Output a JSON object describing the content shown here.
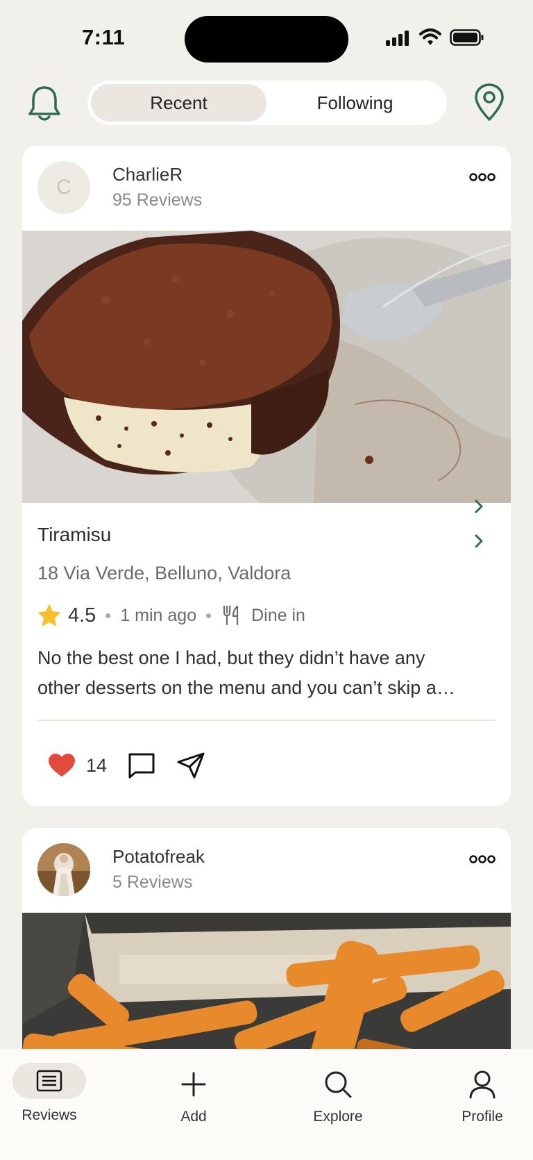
{
  "status_bar": {
    "time": "7:11"
  },
  "header": {
    "tabs": [
      {
        "label": "Recent",
        "active": true
      },
      {
        "label": "Following",
        "active": false
      }
    ]
  },
  "posts": [
    {
      "user": {
        "name": "CharlieR",
        "initial": "C",
        "reviews": "95 Reviews"
      },
      "dish": "Tiramisu",
      "address": "18 Via Verde, Belluno, Valdora",
      "rating": "4.5",
      "time_ago": "1 min ago",
      "service": "Dine in",
      "text_lines": [
        "No the best one I had, but they didn’t have any",
        "other desserts on the menu and you can’t skip a…"
      ],
      "likes": "14",
      "photo_alt": "tiramisu-photo"
    },
    {
      "user": {
        "name": "Potatofreak",
        "reviews": "5 Reviews"
      },
      "photo_alt": "fries-photo"
    }
  ],
  "nav": {
    "items": [
      {
        "label": "Reviews",
        "icon": "reviews-icon",
        "active": true
      },
      {
        "label": "Add",
        "icon": "add-icon",
        "active": false
      },
      {
        "label": "Explore",
        "icon": "search-icon",
        "active": false
      },
      {
        "label": "Profile",
        "icon": "profile-icon",
        "active": false
      }
    ]
  },
  "colors": {
    "accent_green": "#2e6b57",
    "heart_red": "#e24b3b",
    "star_yellow": "#f5c02c",
    "background": "#f2f0eb"
  }
}
